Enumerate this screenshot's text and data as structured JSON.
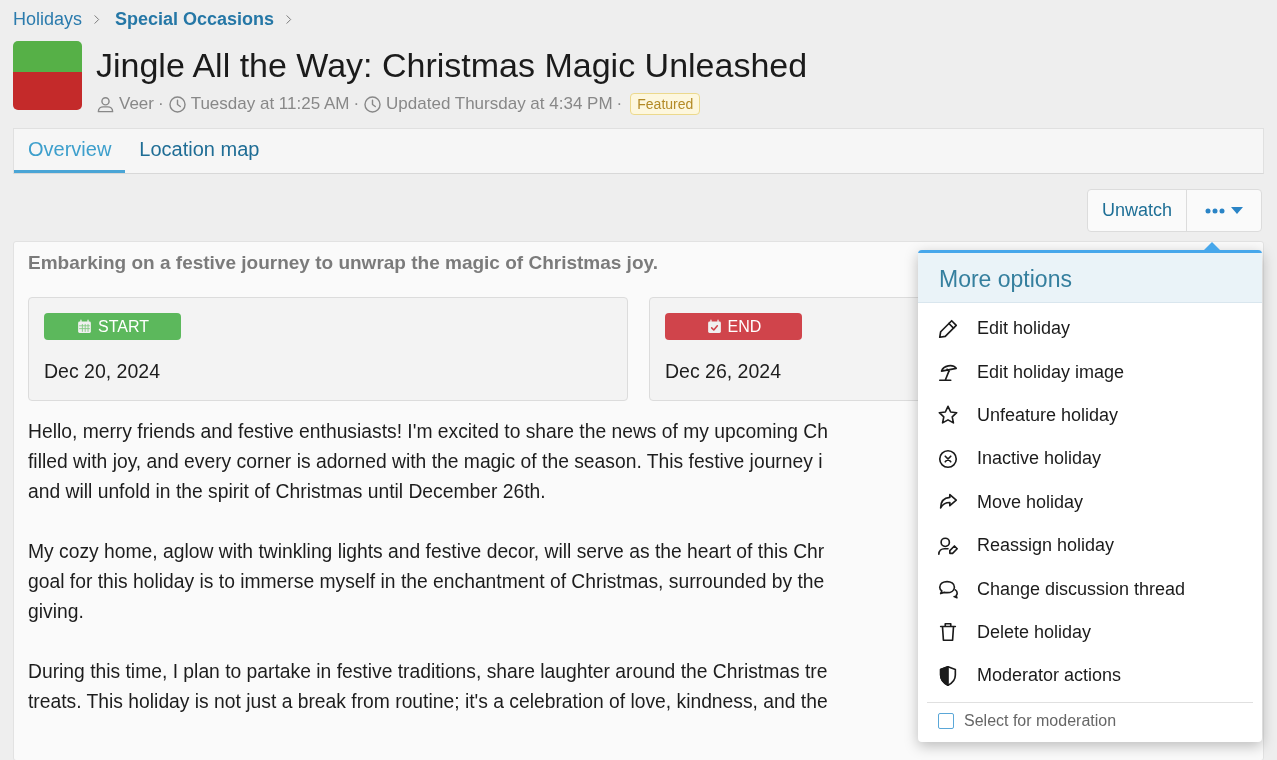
{
  "breadcrumb": [
    {
      "label": "Holidays"
    },
    {
      "label": "Special Occasions"
    }
  ],
  "title": "Jingle All the Way: Christmas Magic Unleashed",
  "meta": {
    "author": "Veer",
    "created": "Tuesday at 11:25 AM",
    "updated": "Updated Thursday at 4:34 PM",
    "badge": "Featured",
    "separators": [
      "·",
      "·",
      "·"
    ]
  },
  "tabs": [
    {
      "label": "Overview",
      "selected": true
    },
    {
      "label": "Location map",
      "selected": false
    }
  ],
  "actions": {
    "watch_button": "Unwatch"
  },
  "summary": "Embarking on a festive journey to unwrap the magic of Christmas joy.",
  "dates": [
    {
      "kind": "start",
      "label": "START",
      "date": "Dec 20, 2024"
    },
    {
      "kind": "end",
      "label": "END",
      "date": "Dec 26, 2024"
    }
  ],
  "paragraphs": [
    [
      "Hello, merry friends and festive enthusiasts! I'm excited to share the news of my upcoming Ch",
      "filled with joy, and every corner is adorned with the magic of the season. This festive journey i",
      "and will unfold in the spirit of Christmas until December 26th."
    ],
    [
      "My cozy home, aglow with twinkling lights and festive decor, will serve as the heart of this Chr",
      "goal for this holiday is to immerse myself in the enchantment of Christmas, surrounded by the",
      "giving."
    ],
    [
      "During this time, I plan to partake in festive traditions, share laughter around the Christmas tre",
      "treats. This holiday is not just a break from routine; it's a celebration of love, kindness, and the"
    ]
  ],
  "menu": {
    "title": "More options",
    "items": [
      {
        "label": "Edit holiday"
      },
      {
        "label": "Edit holiday image"
      },
      {
        "label": "Unfeature holiday"
      },
      {
        "label": "Inactive holiday"
      },
      {
        "label": "Move holiday"
      },
      {
        "label": "Reassign holiday"
      },
      {
        "label": "Change discussion thread"
      },
      {
        "label": "Delete holiday"
      },
      {
        "label": "Moderator actions"
      }
    ],
    "select": {
      "label": "Select for moderation",
      "checked": false
    }
  }
}
